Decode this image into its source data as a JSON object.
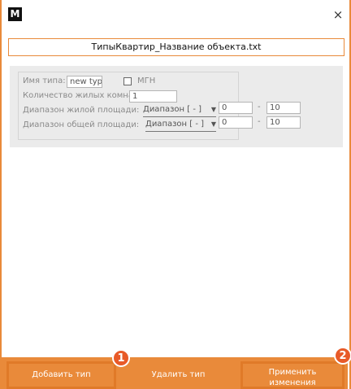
{
  "window": {
    "app_icon_letter": "M",
    "close_glyph": "×",
    "file_title": "ТипыКвартир_Название объекта.txt"
  },
  "type_card": {
    "name_label": "Имя типа:",
    "name_value": "new type",
    "mgn_label": "МГН",
    "mgn_checked": false,
    "rooms_label": "Количество жилых комнат:",
    "rooms_value": "1",
    "living_area_label": "Диапазон жилой площади:",
    "living_area_mode": "Диапазон [ - ]",
    "living_area_min": "0",
    "living_area_max": "10",
    "total_area_label": "Диапазон общей площади:",
    "total_area_mode": "Диапазон [ - ]",
    "total_area_min": "0",
    "total_area_max": "10",
    "dash": "-",
    "dropdown_arrow": "▼"
  },
  "footer": {
    "add_label": "Добавить тип",
    "delete_label": "Удалить тип",
    "apply_label_line1": "Применить",
    "apply_label_line2": "изменения"
  },
  "badges": {
    "badge1": "1",
    "badge2": "2"
  },
  "colors": {
    "accent": "#e98a3a",
    "badge": "#e85a28",
    "panel": "#ebebeb"
  }
}
